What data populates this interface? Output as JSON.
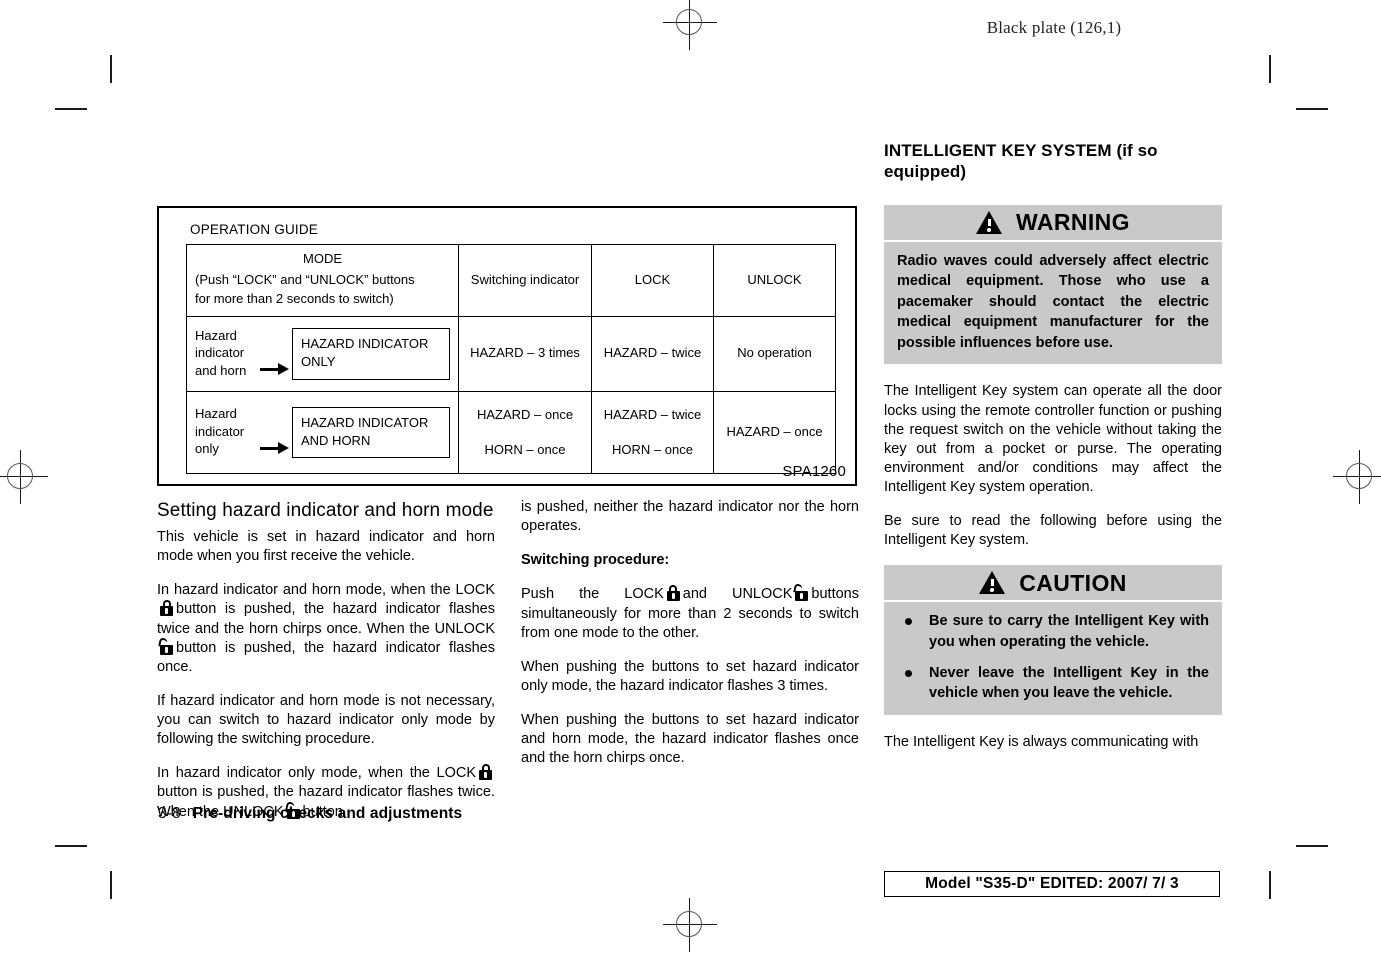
{
  "page": {
    "header_note": "Black plate (126,1)",
    "footer_left_page": "3-8",
    "footer_left_section": "Pre-driving checks and adjustments",
    "footer_right_box": "Model \"S35-D\"  EDITED:  2007/ 7/ 3"
  },
  "figure": {
    "caption": "OPERATION GUIDE",
    "code": "SPA1260",
    "table": {
      "headers": {
        "mode_title": "MODE",
        "mode_note": "(Push “LOCK” and “UNLOCK” buttons\nfor more than 2 seconds to switch)",
        "switching_indicator": "Switching indicator",
        "lock": "LOCK",
        "unlock": "UNLOCK"
      },
      "rows": [
        {
          "mode_from": "Hazard indicator\nand horn",
          "mode_to": "HAZARD INDICATOR\nONLY",
          "switching_indicator": [
            "HAZARD – 3 times"
          ],
          "lock": [
            "HAZARD – twice"
          ],
          "unlock": [
            "No operation"
          ]
        },
        {
          "mode_from": "Hazard indicator\nonly",
          "mode_to": "HAZARD INDICATOR\nAND HORN",
          "switching_indicator": [
            "HAZARD – once",
            "HORN – once"
          ],
          "lock": [
            "HAZARD – twice",
            "HORN – once"
          ],
          "unlock": [
            "HAZARD – once"
          ]
        }
      ]
    }
  },
  "column_left": {
    "heading": "Setting hazard indicator and horn mode",
    "para_1": "This vehicle is set in hazard indicator and horn mode when you first receive the vehicle.",
    "para_2_a": "In hazard indicator and horn mode, when the LOCK",
    "para_2_b": "button is pushed, the hazard indicator flashes twice and the horn chirps once. When the UNLOCK",
    "para_2_c": "button is pushed, the hazard indicator flashes once.",
    "para_3": "If hazard indicator and horn mode is not necessary, you can switch to hazard indicator only mode by following the switching procedure.",
    "para_4_a": "In hazard indicator only mode, when the LOCK",
    "para_4_b": "button is pushed, the hazard indicator flashes twice. When the UNLOCK",
    "para_4_c": "button"
  },
  "column_middle": {
    "para_1": "is pushed, neither the hazard indicator nor the horn operates.",
    "subheading": "Switching procedure:",
    "para_2_a": "Push the LOCK",
    "para_2_b": "and UNLOCK",
    "para_2_c": "buttons simultaneously for more than 2 seconds to switch from one mode to the other.",
    "para_3": "When pushing the buttons to set hazard indicator only mode, the hazard indicator flashes 3 times.",
    "para_4": "When pushing the buttons to set hazard indicator and horn mode, the hazard indicator flashes once and the horn chirps once."
  },
  "column_right": {
    "heading": "INTELLIGENT KEY SYSTEM (if so equipped)",
    "warning": {
      "label": "WARNING",
      "text": "Radio waves could adversely affect electric medical equipment. Those who use a pacemaker should contact the electric medical equipment manufacturer for the possible influences before use."
    },
    "para_1": "The Intelligent Key system can operate all the door locks using the remote controller function or pushing the request switch on the vehicle without taking the key out from a pocket or purse. The operating environment and/or conditions may affect the Intelligent Key system operation.",
    "para_2": "Be sure to read the following before using the Intelligent Key system.",
    "caution": {
      "label": "CAUTION",
      "bullets": [
        "Be sure to carry the Intelligent Key with you when operating the vehicle.",
        "Never leave the Intelligent Key in the vehicle when you leave the vehicle."
      ]
    },
    "para_3": "The Intelligent Key is always communicating with"
  },
  "colors": {
    "alert_gray": "#c9c9c9",
    "ink": "#000000",
    "paper": "#ffffff"
  },
  "icons": {
    "lock": "lock-closed-icon",
    "unlock": "lock-open-icon",
    "alert": "warning-triangle-icon"
  }
}
